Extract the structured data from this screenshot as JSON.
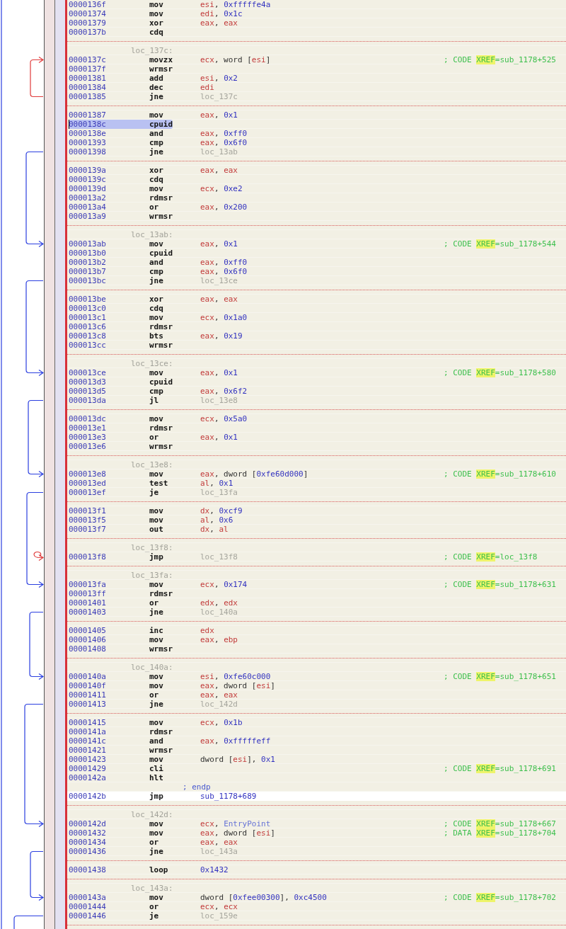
{
  "listing": [
    {
      "kind": "instruction",
      "address": "0000136f",
      "mnemonic": "mov",
      "operands": [
        {
          "kind": "reg",
          "text": "esi"
        },
        {
          "kind": "plain",
          "text": ", "
        },
        {
          "kind": "num",
          "text": "0xfffffe4a"
        }
      ],
      "selected": false,
      "current": false
    },
    {
      "kind": "instruction",
      "address": "00001374",
      "mnemonic": "mov",
      "operands": [
        {
          "kind": "reg",
          "text": "edi"
        },
        {
          "kind": "plain",
          "text": ", "
        },
        {
          "kind": "num",
          "text": "0x1c"
        }
      ],
      "selected": false,
      "current": false
    },
    {
      "kind": "instruction",
      "address": "00001379",
      "mnemonic": "xor",
      "operands": [
        {
          "kind": "reg",
          "text": "eax"
        },
        {
          "kind": "plain",
          "text": ", "
        },
        {
          "kind": "reg",
          "text": "eax"
        }
      ],
      "selected": false,
      "current": false
    },
    {
      "kind": "instruction",
      "address": "0000137b",
      "mnemonic": "cdq",
      "selected": false,
      "current": false
    },
    {
      "kind": "separator"
    },
    {
      "kind": "label",
      "text": "loc_137c:"
    },
    {
      "kind": "instruction",
      "address": "0000137c",
      "mnemonic": "movzx",
      "operands": [
        {
          "kind": "reg",
          "text": "ecx"
        },
        {
          "kind": "plain",
          "text": ", word ["
        },
        {
          "kind": "reg",
          "text": "esi"
        },
        {
          "kind": "plain",
          "text": "]"
        }
      ],
      "comment": {
        "lead": "; CODE ",
        "tag": "XREF",
        "target": "=sub_1178+525"
      },
      "selected": false,
      "current": false
    },
    {
      "kind": "instruction",
      "address": "0000137f",
      "mnemonic": "wrmsr",
      "selected": false,
      "current": false
    },
    {
      "kind": "instruction",
      "address": "00001381",
      "mnemonic": "add",
      "operands": [
        {
          "kind": "reg",
          "text": "esi"
        },
        {
          "kind": "plain",
          "text": ", "
        },
        {
          "kind": "num",
          "text": "0x2"
        }
      ],
      "selected": false,
      "current": false
    },
    {
      "kind": "instruction",
      "address": "00001384",
      "mnemonic": "dec",
      "operands": [
        {
          "kind": "reg",
          "text": "edi"
        }
      ],
      "selected": false,
      "current": false
    },
    {
      "kind": "instruction",
      "address": "00001385",
      "mnemonic": "jne",
      "operands": [
        {
          "kind": "ref",
          "text": "loc_137c"
        }
      ],
      "selected": false,
      "current": false
    },
    {
      "kind": "separator"
    },
    {
      "kind": "instruction",
      "address": "00001387",
      "mnemonic": "mov",
      "operands": [
        {
          "kind": "reg",
          "text": "eax"
        },
        {
          "kind": "plain",
          "text": ", "
        },
        {
          "kind": "num",
          "text": "0x1"
        }
      ],
      "selected": false,
      "current": false
    },
    {
      "kind": "instruction",
      "address": "0000138c",
      "mnemonic": "cpuid",
      "selected": true,
      "current": false
    },
    {
      "kind": "instruction",
      "address": "0000138e",
      "mnemonic": "and",
      "operands": [
        {
          "kind": "reg",
          "text": "eax"
        },
        {
          "kind": "plain",
          "text": ", "
        },
        {
          "kind": "num",
          "text": "0xff0"
        }
      ],
      "selected": false,
      "current": false
    },
    {
      "kind": "instruction",
      "address": "00001393",
      "mnemonic": "cmp",
      "operands": [
        {
          "kind": "reg",
          "text": "eax"
        },
        {
          "kind": "plain",
          "text": ", "
        },
        {
          "kind": "num",
          "text": "0x6f0"
        }
      ],
      "selected": false,
      "current": false
    },
    {
      "kind": "instruction",
      "address": "00001398",
      "mnemonic": "jne",
      "operands": [
        {
          "kind": "ref",
          "text": "loc_13ab"
        }
      ],
      "selected": false,
      "current": false
    },
    {
      "kind": "separator"
    },
    {
      "kind": "instruction",
      "address": "0000139a",
      "mnemonic": "xor",
      "operands": [
        {
          "kind": "reg",
          "text": "eax"
        },
        {
          "kind": "plain",
          "text": ", "
        },
        {
          "kind": "reg",
          "text": "eax"
        }
      ],
      "selected": false,
      "current": false
    },
    {
      "kind": "instruction",
      "address": "0000139c",
      "mnemonic": "cdq",
      "selected": false,
      "current": false
    },
    {
      "kind": "instruction",
      "address": "0000139d",
      "mnemonic": "mov",
      "operands": [
        {
          "kind": "reg",
          "text": "ecx"
        },
        {
          "kind": "plain",
          "text": ", "
        },
        {
          "kind": "num",
          "text": "0xe2"
        }
      ],
      "selected": false,
      "current": false
    },
    {
      "kind": "instruction",
      "address": "000013a2",
      "mnemonic": "rdmsr",
      "selected": false,
      "current": false
    },
    {
      "kind": "instruction",
      "address": "000013a4",
      "mnemonic": "or",
      "operands": [
        {
          "kind": "reg",
          "text": "eax"
        },
        {
          "kind": "plain",
          "text": ", "
        },
        {
          "kind": "num",
          "text": "0x200"
        }
      ],
      "selected": false,
      "current": false
    },
    {
      "kind": "instruction",
      "address": "000013a9",
      "mnemonic": "wrmsr",
      "selected": false,
      "current": false
    },
    {
      "kind": "separator"
    },
    {
      "kind": "label",
      "text": "loc_13ab:"
    },
    {
      "kind": "instruction",
      "address": "000013ab",
      "mnemonic": "mov",
      "operands": [
        {
          "kind": "reg",
          "text": "eax"
        },
        {
          "kind": "plain",
          "text": ", "
        },
        {
          "kind": "num",
          "text": "0x1"
        }
      ],
      "comment": {
        "lead": "; CODE ",
        "tag": "XREF",
        "target": "=sub_1178+544"
      },
      "selected": false,
      "current": false
    },
    {
      "kind": "instruction",
      "address": "000013b0",
      "mnemonic": "cpuid",
      "selected": false,
      "current": false
    },
    {
      "kind": "instruction",
      "address": "000013b2",
      "mnemonic": "and",
      "operands": [
        {
          "kind": "reg",
          "text": "eax"
        },
        {
          "kind": "plain",
          "text": ", "
        },
        {
          "kind": "num",
          "text": "0xff0"
        }
      ],
      "selected": false,
      "current": false
    },
    {
      "kind": "instruction",
      "address": "000013b7",
      "mnemonic": "cmp",
      "operands": [
        {
          "kind": "reg",
          "text": "eax"
        },
        {
          "kind": "plain",
          "text": ", "
        },
        {
          "kind": "num",
          "text": "0x6f0"
        }
      ],
      "selected": false,
      "current": false
    },
    {
      "kind": "instruction",
      "address": "000013bc",
      "mnemonic": "jne",
      "operands": [
        {
          "kind": "ref",
          "text": "loc_13ce"
        }
      ],
      "selected": false,
      "current": false
    },
    {
      "kind": "separator"
    },
    {
      "kind": "instruction",
      "address": "000013be",
      "mnemonic": "xor",
      "operands": [
        {
          "kind": "reg",
          "text": "eax"
        },
        {
          "kind": "plain",
          "text": ", "
        },
        {
          "kind": "reg",
          "text": "eax"
        }
      ],
      "selected": false,
      "current": false
    },
    {
      "kind": "instruction",
      "address": "000013c0",
      "mnemonic": "cdq",
      "selected": false,
      "current": false
    },
    {
      "kind": "instruction",
      "address": "000013c1",
      "mnemonic": "mov",
      "operands": [
        {
          "kind": "reg",
          "text": "ecx"
        },
        {
          "kind": "plain",
          "text": ", "
        },
        {
          "kind": "num",
          "text": "0x1a0"
        }
      ],
      "selected": false,
      "current": false
    },
    {
      "kind": "instruction",
      "address": "000013c6",
      "mnemonic": "rdmsr",
      "selected": false,
      "current": false
    },
    {
      "kind": "instruction",
      "address": "000013c8",
      "mnemonic": "bts",
      "operands": [
        {
          "kind": "reg",
          "text": "eax"
        },
        {
          "kind": "plain",
          "text": ", "
        },
        {
          "kind": "num",
          "text": "0x19"
        }
      ],
      "selected": false,
      "current": false
    },
    {
      "kind": "instruction",
      "address": "000013cc",
      "mnemonic": "wrmsr",
      "selected": false,
      "current": false
    },
    {
      "kind": "separator"
    },
    {
      "kind": "label",
      "text": "loc_13ce:"
    },
    {
      "kind": "instruction",
      "address": "000013ce",
      "mnemonic": "mov",
      "operands": [
        {
          "kind": "reg",
          "text": "eax"
        },
        {
          "kind": "plain",
          "text": ", "
        },
        {
          "kind": "num",
          "text": "0x1"
        }
      ],
      "comment": {
        "lead": "; CODE ",
        "tag": "XREF",
        "target": "=sub_1178+580"
      },
      "selected": false,
      "current": false
    },
    {
      "kind": "instruction",
      "address": "000013d3",
      "mnemonic": "cpuid",
      "selected": false,
      "current": false
    },
    {
      "kind": "instruction",
      "address": "000013d5",
      "mnemonic": "cmp",
      "operands": [
        {
          "kind": "reg",
          "text": "eax"
        },
        {
          "kind": "plain",
          "text": ", "
        },
        {
          "kind": "num",
          "text": "0x6f2"
        }
      ],
      "selected": false,
      "current": false
    },
    {
      "kind": "instruction",
      "address": "000013da",
      "mnemonic": "jl",
      "operands": [
        {
          "kind": "ref",
          "text": "loc_13e8"
        }
      ],
      "selected": false,
      "current": false
    },
    {
      "kind": "separator"
    },
    {
      "kind": "instruction",
      "address": "000013dc",
      "mnemonic": "mov",
      "operands": [
        {
          "kind": "reg",
          "text": "ecx"
        },
        {
          "kind": "plain",
          "text": ", "
        },
        {
          "kind": "num",
          "text": "0x5a0"
        }
      ],
      "selected": false,
      "current": false
    },
    {
      "kind": "instruction",
      "address": "000013e1",
      "mnemonic": "rdmsr",
      "selected": false,
      "current": false
    },
    {
      "kind": "instruction",
      "address": "000013e3",
      "mnemonic": "or",
      "operands": [
        {
          "kind": "reg",
          "text": "eax"
        },
        {
          "kind": "plain",
          "text": ", "
        },
        {
          "kind": "num",
          "text": "0x1"
        }
      ],
      "selected": false,
      "current": false
    },
    {
      "kind": "instruction",
      "address": "000013e6",
      "mnemonic": "wrmsr",
      "selected": false,
      "current": false
    },
    {
      "kind": "separator"
    },
    {
      "kind": "label",
      "text": "loc_13e8:"
    },
    {
      "kind": "instruction",
      "address": "000013e8",
      "mnemonic": "mov",
      "operands": [
        {
          "kind": "reg",
          "text": "eax"
        },
        {
          "kind": "plain",
          "text": ", dword ["
        },
        {
          "kind": "num",
          "text": "0xfe60d000"
        },
        {
          "kind": "plain",
          "text": "]"
        }
      ],
      "comment": {
        "lead": "; CODE ",
        "tag": "XREF",
        "target": "=sub_1178+610"
      },
      "selected": false,
      "current": false
    },
    {
      "kind": "instruction",
      "address": "000013ed",
      "mnemonic": "test",
      "operands": [
        {
          "kind": "reg",
          "text": "al"
        },
        {
          "kind": "plain",
          "text": ", "
        },
        {
          "kind": "num",
          "text": "0x1"
        }
      ],
      "selected": false,
      "current": false
    },
    {
      "kind": "instruction",
      "address": "000013ef",
      "mnemonic": "je",
      "operands": [
        {
          "kind": "ref",
          "text": "loc_13fa"
        }
      ],
      "selected": false,
      "current": false
    },
    {
      "kind": "separator"
    },
    {
      "kind": "instruction",
      "address": "000013f1",
      "mnemonic": "mov",
      "operands": [
        {
          "kind": "reg",
          "text": "dx"
        },
        {
          "kind": "plain",
          "text": ", "
        },
        {
          "kind": "num",
          "text": "0xcf9"
        }
      ],
      "selected": false,
      "current": false
    },
    {
      "kind": "instruction",
      "address": "000013f5",
      "mnemonic": "mov",
      "operands": [
        {
          "kind": "reg",
          "text": "al"
        },
        {
          "kind": "plain",
          "text": ", "
        },
        {
          "kind": "num",
          "text": "0x6"
        }
      ],
      "selected": false,
      "current": false
    },
    {
      "kind": "instruction",
      "address": "000013f7",
      "mnemonic": "out",
      "operands": [
        {
          "kind": "reg",
          "text": "dx"
        },
        {
          "kind": "plain",
          "text": ", "
        },
        {
          "kind": "reg",
          "text": "al"
        }
      ],
      "selected": false,
      "current": false
    },
    {
      "kind": "separator"
    },
    {
      "kind": "label",
      "text": "loc_13f8:"
    },
    {
      "kind": "instruction",
      "address": "000013f8",
      "mnemonic": "jmp",
      "operands": [
        {
          "kind": "ref",
          "text": "loc_13f8"
        }
      ],
      "comment": {
        "lead": "; CODE ",
        "tag": "XREF",
        "target": "=loc_13f8"
      },
      "selected": false,
      "current": false
    },
    {
      "kind": "separator"
    },
    {
      "kind": "label",
      "text": "loc_13fa:"
    },
    {
      "kind": "instruction",
      "address": "000013fa",
      "mnemonic": "mov",
      "operands": [
        {
          "kind": "reg",
          "text": "ecx"
        },
        {
          "kind": "plain",
          "text": ", "
        },
        {
          "kind": "num",
          "text": "0x174"
        }
      ],
      "comment": {
        "lead": "; CODE ",
        "tag": "XREF",
        "target": "=sub_1178+631"
      },
      "selected": false,
      "current": false
    },
    {
      "kind": "instruction",
      "address": "000013ff",
      "mnemonic": "rdmsr",
      "selected": false,
      "current": false
    },
    {
      "kind": "instruction",
      "address": "00001401",
      "mnemonic": "or",
      "operands": [
        {
          "kind": "reg",
          "text": "edx"
        },
        {
          "kind": "plain",
          "text": ", "
        },
        {
          "kind": "reg",
          "text": "edx"
        }
      ],
      "selected": false,
      "current": false
    },
    {
      "kind": "instruction",
      "address": "00001403",
      "mnemonic": "jne",
      "operands": [
        {
          "kind": "ref",
          "text": "loc_140a"
        }
      ],
      "selected": false,
      "current": false
    },
    {
      "kind": "separator"
    },
    {
      "kind": "instruction",
      "address": "00001405",
      "mnemonic": "inc",
      "operands": [
        {
          "kind": "reg",
          "text": "edx"
        }
      ],
      "selected": false,
      "current": false
    },
    {
      "kind": "instruction",
      "address": "00001406",
      "mnemonic": "mov",
      "operands": [
        {
          "kind": "reg",
          "text": "eax"
        },
        {
          "kind": "plain",
          "text": ", "
        },
        {
          "kind": "reg",
          "text": "ebp"
        }
      ],
      "selected": false,
      "current": false
    },
    {
      "kind": "instruction",
      "address": "00001408",
      "mnemonic": "wrmsr",
      "selected": false,
      "current": false
    },
    {
      "kind": "separator"
    },
    {
      "kind": "label",
      "text": "loc_140a:"
    },
    {
      "kind": "instruction",
      "address": "0000140a",
      "mnemonic": "mov",
      "operands": [
        {
          "kind": "reg",
          "text": "esi"
        },
        {
          "kind": "plain",
          "text": ", "
        },
        {
          "kind": "num",
          "text": "0xfe60c000"
        }
      ],
      "comment": {
        "lead": "; CODE ",
        "tag": "XREF",
        "target": "=sub_1178+651"
      },
      "selected": false,
      "current": false
    },
    {
      "kind": "instruction",
      "address": "0000140f",
      "mnemonic": "mov",
      "operands": [
        {
          "kind": "reg",
          "text": "eax"
        },
        {
          "kind": "plain",
          "text": ", dword ["
        },
        {
          "kind": "reg",
          "text": "esi"
        },
        {
          "kind": "plain",
          "text": "]"
        }
      ],
      "selected": false,
      "current": false
    },
    {
      "kind": "instruction",
      "address": "00001411",
      "mnemonic": "or",
      "operands": [
        {
          "kind": "reg",
          "text": "eax"
        },
        {
          "kind": "plain",
          "text": ", "
        },
        {
          "kind": "reg",
          "text": "eax"
        }
      ],
      "selected": false,
      "current": false
    },
    {
      "kind": "instruction",
      "address": "00001413",
      "mnemonic": "jne",
      "operands": [
        {
          "kind": "ref",
          "text": "loc_142d"
        }
      ],
      "selected": false,
      "current": false
    },
    {
      "kind": "separator"
    },
    {
      "kind": "instruction",
      "address": "00001415",
      "mnemonic": "mov",
      "operands": [
        {
          "kind": "reg",
          "text": "ecx"
        },
        {
          "kind": "plain",
          "text": ", "
        },
        {
          "kind": "num",
          "text": "0x1b"
        }
      ],
      "selected": false,
      "current": false
    },
    {
      "kind": "instruction",
      "address": "0000141a",
      "mnemonic": "rdmsr",
      "selected": false,
      "current": false
    },
    {
      "kind": "instruction",
      "address": "0000141c",
      "mnemonic": "and",
      "operands": [
        {
          "kind": "reg",
          "text": "eax"
        },
        {
          "kind": "plain",
          "text": ", "
        },
        {
          "kind": "num",
          "text": "0xfffffeff"
        }
      ],
      "selected": false,
      "current": false
    },
    {
      "kind": "instruction",
      "address": "00001421",
      "mnemonic": "wrmsr",
      "selected": false,
      "current": false
    },
    {
      "kind": "instruction",
      "address": "00001423",
      "mnemonic": "mov",
      "operands": [
        {
          "kind": "plain",
          "text": "dword ["
        },
        {
          "kind": "reg",
          "text": "esi"
        },
        {
          "kind": "plain",
          "text": "], "
        },
        {
          "kind": "num",
          "text": "0x1"
        }
      ],
      "selected": false,
      "current": false
    },
    {
      "kind": "instruction",
      "address": "00001429",
      "mnemonic": "cli",
      "comment": {
        "lead": "; CODE ",
        "tag": "XREF",
        "target": "=sub_1178+691"
      },
      "selected": false,
      "current": false
    },
    {
      "kind": "instruction",
      "address": "0000142a",
      "mnemonic": "hlt",
      "selected": false,
      "current": false
    },
    {
      "kind": "endp",
      "text": "; endp"
    },
    {
      "kind": "instruction",
      "address": "0000142b",
      "mnemonic": "jmp",
      "operands": [
        {
          "kind": "num",
          "text": "sub_1178+689"
        }
      ],
      "selected": false,
      "current": true
    },
    {
      "kind": "separator"
    },
    {
      "kind": "label",
      "text": "loc_142d:"
    },
    {
      "kind": "instruction",
      "address": "0000142d",
      "mnemonic": "mov",
      "operands": [
        {
          "kind": "reg",
          "text": "ecx"
        },
        {
          "kind": "plain",
          "text": ", "
        },
        {
          "kind": "sym",
          "text": "EntryPoint"
        }
      ],
      "comment": {
        "lead": "; CODE ",
        "tag": "XREF",
        "target": "=sub_1178+667"
      },
      "selected": false,
      "current": false
    },
    {
      "kind": "instruction",
      "address": "00001432",
      "mnemonic": "mov",
      "operands": [
        {
          "kind": "reg",
          "text": "eax"
        },
        {
          "kind": "plain",
          "text": ", dword ["
        },
        {
          "kind": "reg",
          "text": "esi"
        },
        {
          "kind": "plain",
          "text": "]"
        }
      ],
      "comment": {
        "lead": "; DATA ",
        "tag": "XREF",
        "target": "=sub_1178+704"
      },
      "selected": false,
      "current": false
    },
    {
      "kind": "instruction",
      "address": "00001434",
      "mnemonic": "or",
      "operands": [
        {
          "kind": "reg",
          "text": "eax"
        },
        {
          "kind": "plain",
          "text": ", "
        },
        {
          "kind": "reg",
          "text": "eax"
        }
      ],
      "selected": false,
      "current": false
    },
    {
      "kind": "instruction",
      "address": "00001436",
      "mnemonic": "jne",
      "operands": [
        {
          "kind": "ref",
          "text": "loc_143a"
        }
      ],
      "selected": false,
      "current": false
    },
    {
      "kind": "separator"
    },
    {
      "kind": "instruction",
      "address": "00001438",
      "mnemonic": "loop",
      "operands": [
        {
          "kind": "num",
          "text": "0x1432"
        }
      ],
      "selected": false,
      "current": false
    },
    {
      "kind": "separator"
    },
    {
      "kind": "label",
      "text": "loc_143a:"
    },
    {
      "kind": "instruction",
      "address": "0000143a",
      "mnemonic": "mov",
      "operands": [
        {
          "kind": "plain",
          "text": "dword ["
        },
        {
          "kind": "num",
          "text": "0xfee00300"
        },
        {
          "kind": "plain",
          "text": "], "
        },
        {
          "kind": "num",
          "text": "0xc4500"
        }
      ],
      "comment": {
        "lead": "; CODE ",
        "tag": "XREF",
        "target": "=sub_1178+702"
      },
      "selected": false,
      "current": false
    },
    {
      "kind": "instruction",
      "address": "00001444",
      "mnemonic": "or",
      "operands": [
        {
          "kind": "reg",
          "text": "ecx"
        },
        {
          "kind": "plain",
          "text": ", "
        },
        {
          "kind": "reg",
          "text": "ecx"
        }
      ],
      "selected": false,
      "current": false
    },
    {
      "kind": "instruction",
      "address": "00001446",
      "mnemonic": "je",
      "operands": [
        {
          "kind": "ref",
          "text": "loc_159e"
        }
      ],
      "selected": false,
      "current": false
    },
    {
      "kind": "separator"
    }
  ]
}
